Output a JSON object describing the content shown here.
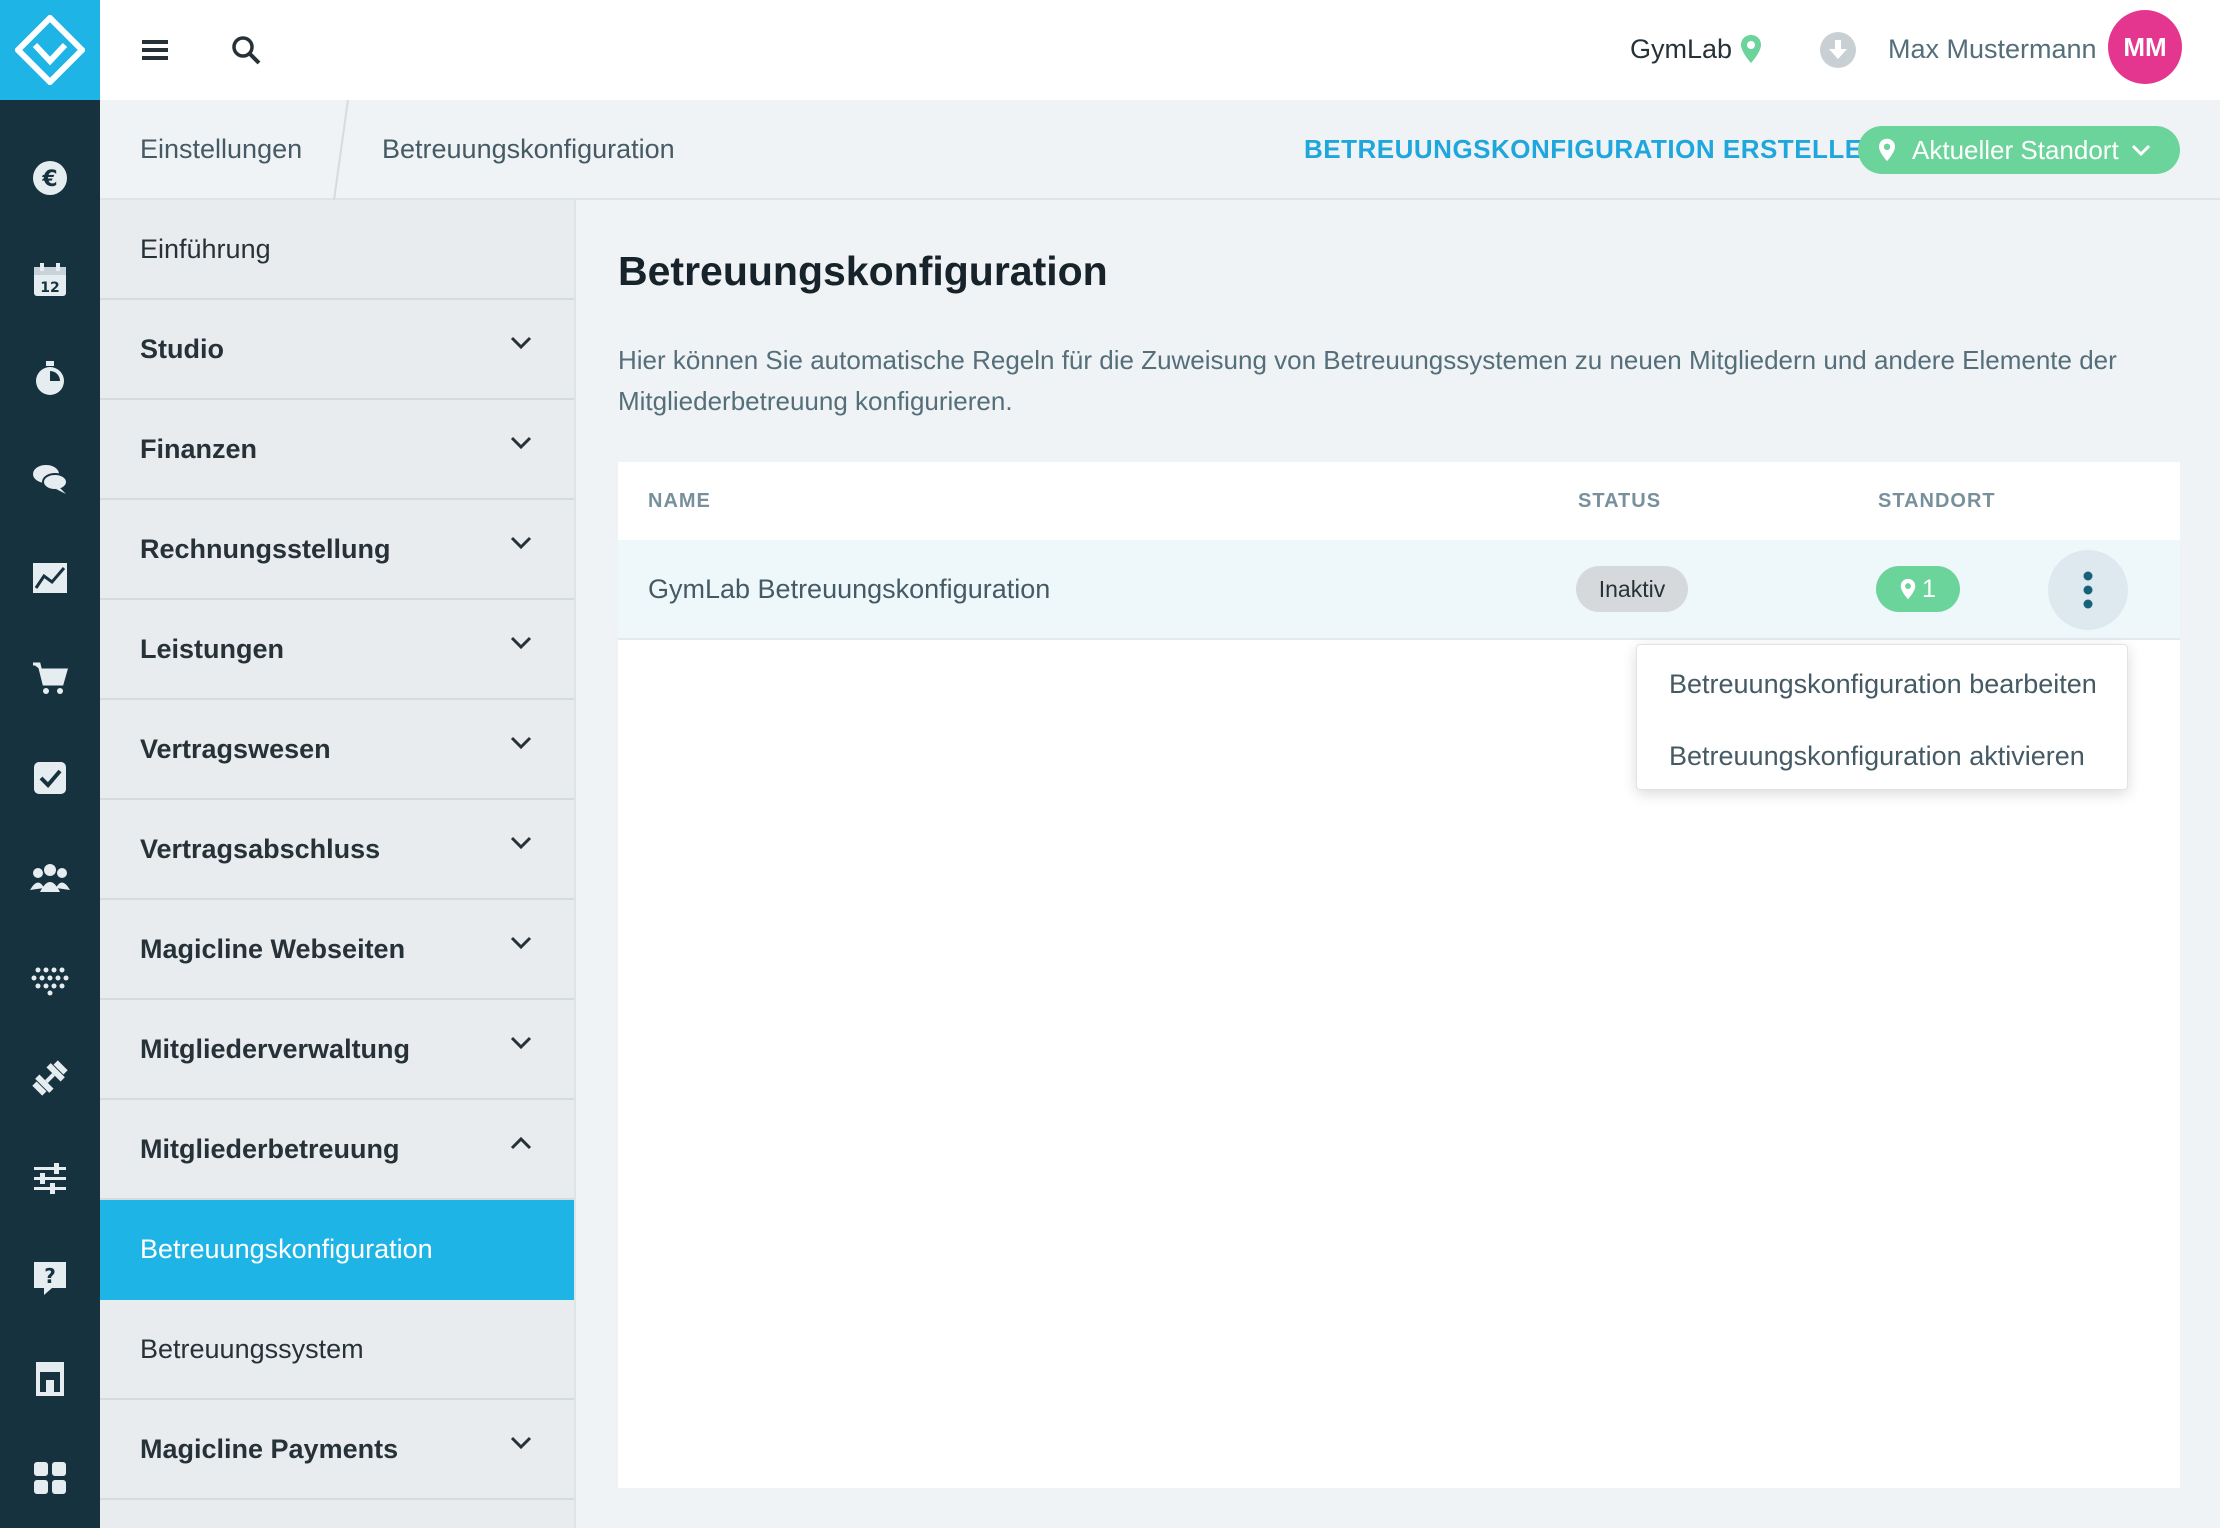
{
  "topbar": {
    "studio": "GymLab",
    "user_name": "Max Mustermann",
    "avatar_initials": "MM"
  },
  "breadcrumb": {
    "items": [
      "Einstellungen",
      "Betreuungskonfiguration"
    ]
  },
  "actions": {
    "create_label": "BETREUUNGSKONFIGURATION ERSTELLEN",
    "location_label": "Aktueller Standort"
  },
  "settings_nav": {
    "items": [
      {
        "label": "Einführung"
      },
      {
        "label": "Studio"
      },
      {
        "label": "Finanzen"
      },
      {
        "label": "Rechnungsstellung"
      },
      {
        "label": "Leistungen"
      },
      {
        "label": "Vertragswesen"
      },
      {
        "label": "Vertragsabschluss"
      },
      {
        "label": "Magicline Webseiten"
      },
      {
        "label": "Mitgliederverwaltung"
      },
      {
        "label": "Mitgliederbetreuung"
      },
      {
        "label": "Betreuungskonfiguration"
      },
      {
        "label": "Betreuungssystem"
      },
      {
        "label": "Magicline Payments"
      }
    ]
  },
  "rail": {
    "icons": [
      "euro-icon",
      "calendar-icon",
      "stopwatch-icon",
      "chat-icon",
      "chart-icon",
      "cart-icon",
      "checkbox-icon",
      "members-icon",
      "dots-grid-icon",
      "dumbbell-icon",
      "sliders-icon",
      "help-icon",
      "shop-icon",
      "apps-icon"
    ]
  },
  "main": {
    "title": "Betreuungskonfiguration",
    "description": "Hier können Sie automatische Regeln für die Zuweisung von Betreuungssystemen zu neuen Mitgliedern und andere Elemente der Mitgliederbetreuung konfigurieren.",
    "table": {
      "columns": [
        "NAME",
        "STATUS",
        "STANDORT"
      ],
      "rows": [
        {
          "name": "GymLab Betreuungskonfiguration",
          "status": "Inaktiv",
          "locations": "1"
        }
      ]
    },
    "context_menu": [
      "Betreuungskonfiguration bearbeiten",
      "Betreuungskonfiguration aktivieren"
    ]
  },
  "colors": {
    "rail_bg": "#17323f",
    "accent": "#1fb4e6",
    "green": "#6bd49a",
    "avatar": "#e5368f"
  }
}
